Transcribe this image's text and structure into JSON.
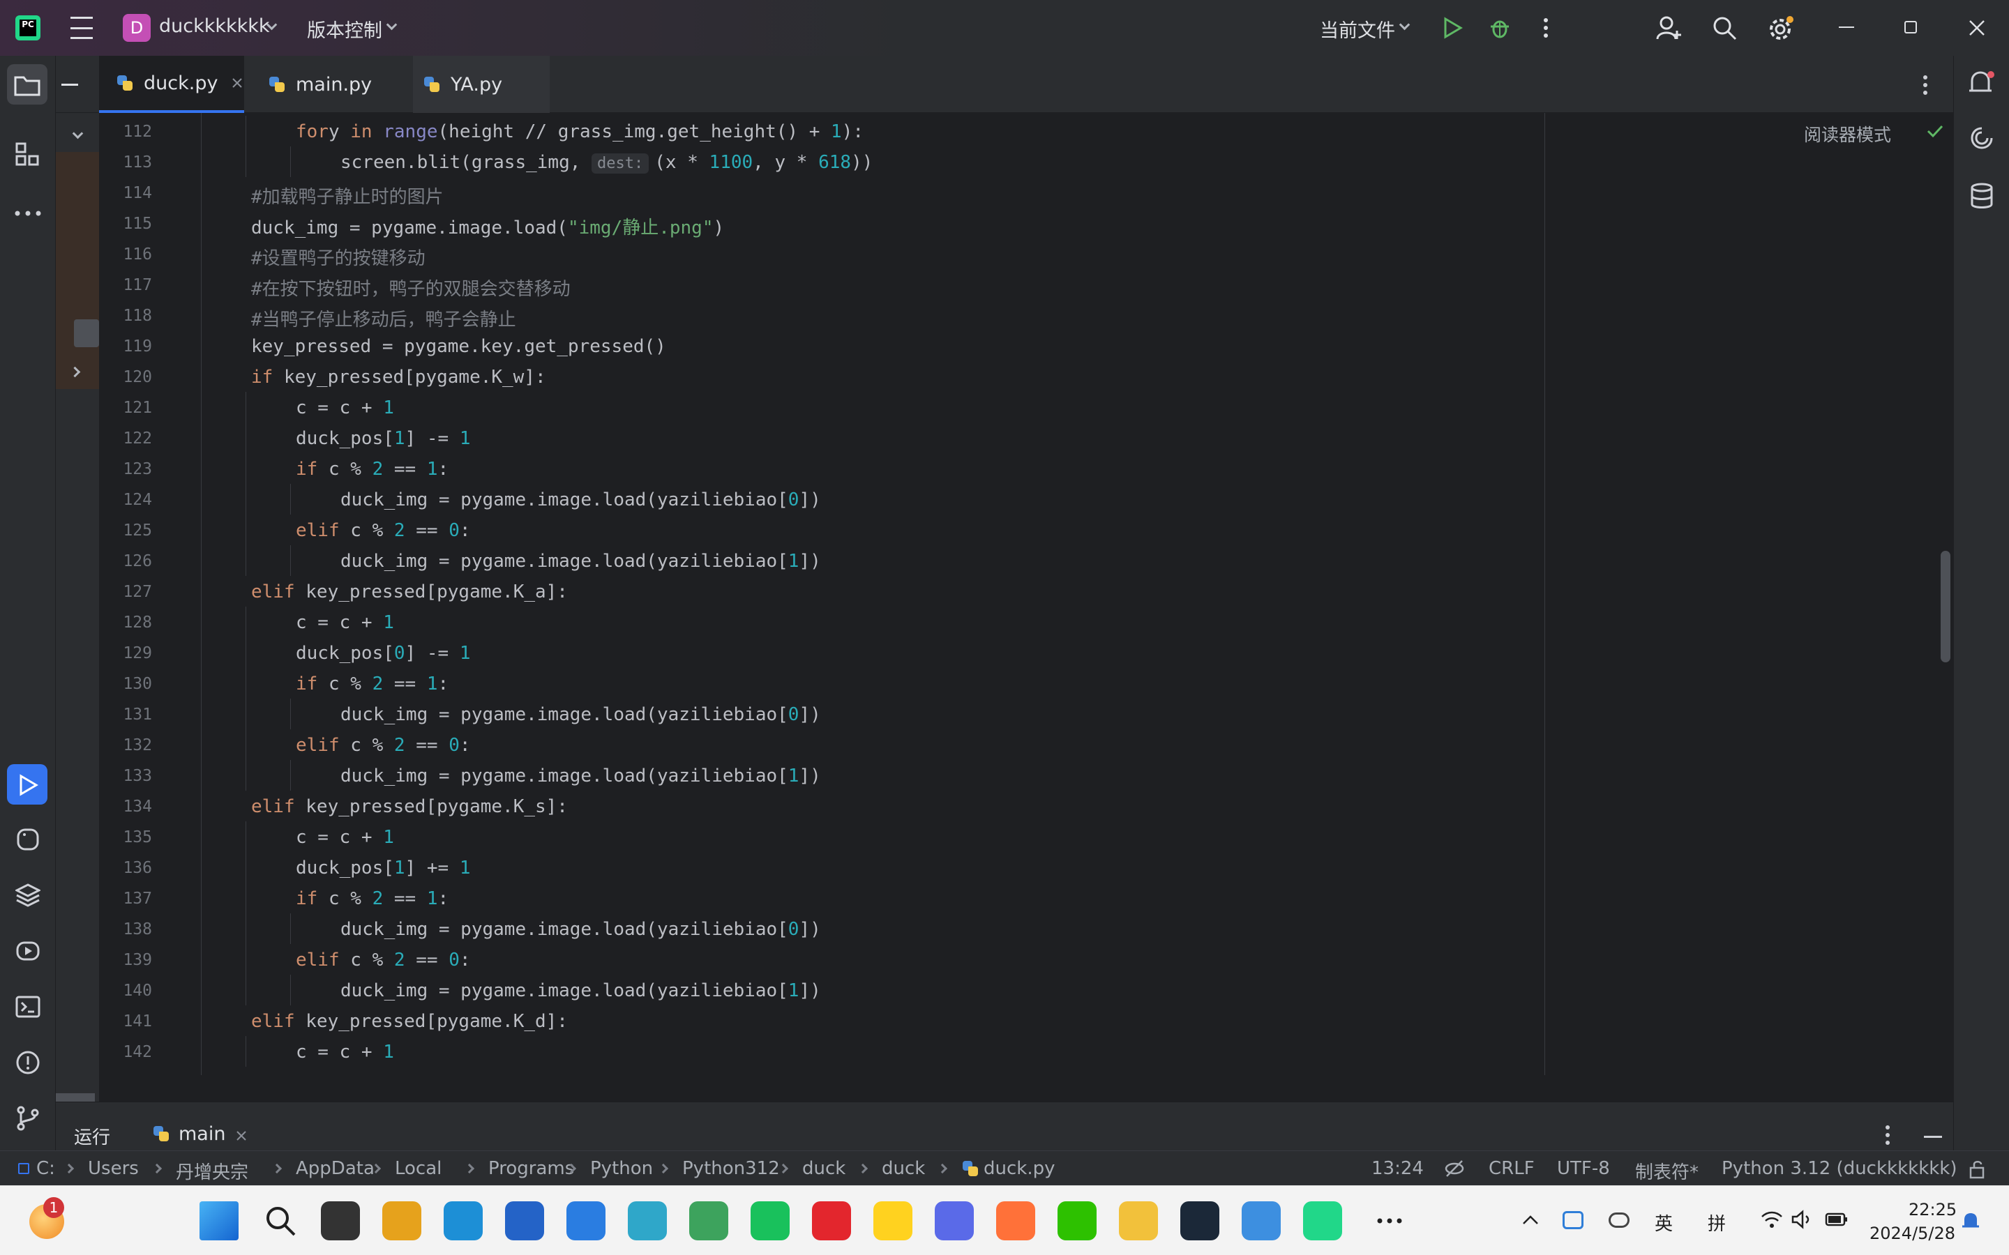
{
  "titlebar": {
    "project_initial": "D",
    "project_name": "duckkkkkkk",
    "vcs": "版本控制",
    "run_config": "当前文件"
  },
  "tabs": [
    {
      "label": "duck.py",
      "active": true
    },
    {
      "label": "main.py",
      "active": false
    },
    {
      "label": "YA.py",
      "active": false
    }
  ],
  "reader_mode": "阅读器模式",
  "inlay_hint": "dest:",
  "code_lines": [
    {
      "n": "112",
      "indent": 2,
      "tokens": [
        [
          "kw",
          "for"
        ],
        [
          "",
          "y "
        ],
        [
          "kw",
          "in"
        ],
        [
          "bi",
          " range"
        ],
        [
          "",
          "(height // grass_img.get_height() + "
        ],
        [
          "num",
          "1"
        ],
        [
          "",
          "):"
        ]
      ]
    },
    {
      "n": "113",
      "indent": 3,
      "tokens": [
        [
          "",
          "screen.blit(grass_img, "
        ],
        [
          "hint",
          ""
        ],
        [
          "",
          "(x * "
        ],
        [
          "num",
          "1100"
        ],
        [
          "",
          ", y * "
        ],
        [
          "num",
          "618"
        ],
        [
          "",
          "))"
        ]
      ]
    },
    {
      "n": "114",
      "indent": 1,
      "tokens": [
        [
          "cm",
          "#加载鸭子静止时的图片"
        ]
      ]
    },
    {
      "n": "115",
      "indent": 1,
      "tokens": [
        [
          "",
          "duck_img = pygame.image.load("
        ],
        [
          "str",
          "\"img/静止.png\""
        ],
        [
          "",
          ")"
        ]
      ]
    },
    {
      "n": "116",
      "indent": 1,
      "tokens": [
        [
          "cm",
          "#设置鸭子的按键移动"
        ]
      ]
    },
    {
      "n": "117",
      "indent": 1,
      "tokens": [
        [
          "cm",
          "#在按下按钮时，鸭子的双腿会交替移动"
        ]
      ]
    },
    {
      "n": "118",
      "indent": 1,
      "tokens": [
        [
          "cm",
          "#当鸭子停止移动后，鸭子会静止"
        ]
      ]
    },
    {
      "n": "119",
      "indent": 1,
      "tokens": [
        [
          "",
          "key_pressed = pygame.key.get_pressed()"
        ]
      ]
    },
    {
      "n": "120",
      "indent": 1,
      "tokens": [
        [
          "kw",
          "if"
        ],
        [
          "",
          " key_pressed[pygame.K_w]:"
        ]
      ]
    },
    {
      "n": "121",
      "indent": 2,
      "tokens": [
        [
          "",
          "c = c + "
        ],
        [
          "num",
          "1"
        ]
      ]
    },
    {
      "n": "122",
      "indent": 2,
      "tokens": [
        [
          "",
          "duck_pos["
        ],
        [
          "num",
          "1"
        ],
        [
          "",
          "] -= "
        ],
        [
          "num",
          "1"
        ]
      ]
    },
    {
      "n": "123",
      "indent": 2,
      "tokens": [
        [
          "kw",
          "if"
        ],
        [
          "",
          " c % "
        ],
        [
          "num",
          "2"
        ],
        [
          "",
          " == "
        ],
        [
          "num",
          "1"
        ],
        [
          "",
          ":"
        ]
      ]
    },
    {
      "n": "124",
      "indent": 3,
      "tokens": [
        [
          "",
          "duck_img = pygame.image.load(yaziliebiao["
        ],
        [
          "num",
          "0"
        ],
        [
          "",
          "])"
        ]
      ]
    },
    {
      "n": "125",
      "indent": 2,
      "tokens": [
        [
          "kw",
          "elif"
        ],
        [
          "",
          " c % "
        ],
        [
          "num",
          "2"
        ],
        [
          "",
          " == "
        ],
        [
          "num",
          "0"
        ],
        [
          "",
          ":"
        ]
      ]
    },
    {
      "n": "126",
      "indent": 3,
      "tokens": [
        [
          "",
          "duck_img = pygame.image.load(yaziliebiao["
        ],
        [
          "num",
          "1"
        ],
        [
          "",
          "])"
        ]
      ]
    },
    {
      "n": "127",
      "indent": 1,
      "tokens": [
        [
          "kw",
          "elif"
        ],
        [
          "",
          " key_pressed[pygame.K_a]:"
        ]
      ]
    },
    {
      "n": "128",
      "indent": 2,
      "tokens": [
        [
          "",
          "c = c + "
        ],
        [
          "num",
          "1"
        ]
      ]
    },
    {
      "n": "129",
      "indent": 2,
      "tokens": [
        [
          "",
          "duck_pos["
        ],
        [
          "num",
          "0"
        ],
        [
          "",
          "] -= "
        ],
        [
          "num",
          "1"
        ]
      ]
    },
    {
      "n": "130",
      "indent": 2,
      "tokens": [
        [
          "kw",
          "if"
        ],
        [
          "",
          " c % "
        ],
        [
          "num",
          "2"
        ],
        [
          "",
          " == "
        ],
        [
          "num",
          "1"
        ],
        [
          "",
          ":"
        ]
      ]
    },
    {
      "n": "131",
      "indent": 3,
      "tokens": [
        [
          "",
          "duck_img = pygame.image.load(yaziliebiao["
        ],
        [
          "num",
          "0"
        ],
        [
          "",
          "])"
        ]
      ]
    },
    {
      "n": "132",
      "indent": 2,
      "tokens": [
        [
          "kw",
          "elif"
        ],
        [
          "",
          " c % "
        ],
        [
          "num",
          "2"
        ],
        [
          "",
          " == "
        ],
        [
          "num",
          "0"
        ],
        [
          "",
          ":"
        ]
      ]
    },
    {
      "n": "133",
      "indent": 3,
      "tokens": [
        [
          "",
          "duck_img = pygame.image.load(yaziliebiao["
        ],
        [
          "num",
          "1"
        ],
        [
          "",
          "])"
        ]
      ]
    },
    {
      "n": "134",
      "indent": 1,
      "tokens": [
        [
          "kw",
          "elif"
        ],
        [
          "",
          " key_pressed[pygame.K_s]:"
        ]
      ]
    },
    {
      "n": "135",
      "indent": 2,
      "tokens": [
        [
          "",
          "c = c + "
        ],
        [
          "num",
          "1"
        ]
      ]
    },
    {
      "n": "136",
      "indent": 2,
      "tokens": [
        [
          "",
          "duck_pos["
        ],
        [
          "num",
          "1"
        ],
        [
          "",
          "] += "
        ],
        [
          "num",
          "1"
        ]
      ]
    },
    {
      "n": "137",
      "indent": 2,
      "tokens": [
        [
          "kw",
          "if"
        ],
        [
          "",
          " c % "
        ],
        [
          "num",
          "2"
        ],
        [
          "",
          " == "
        ],
        [
          "num",
          "1"
        ],
        [
          "",
          ":"
        ]
      ]
    },
    {
      "n": "138",
      "indent": 3,
      "tokens": [
        [
          "",
          "duck_img = pygame.image.load(yaziliebiao["
        ],
        [
          "num",
          "0"
        ],
        [
          "",
          "])"
        ]
      ]
    },
    {
      "n": "139",
      "indent": 2,
      "tokens": [
        [
          "kw",
          "elif"
        ],
        [
          "",
          " c % "
        ],
        [
          "num",
          "2"
        ],
        [
          "",
          " == "
        ],
        [
          "num",
          "0"
        ],
        [
          "",
          ":"
        ]
      ]
    },
    {
      "n": "140",
      "indent": 3,
      "tokens": [
        [
          "",
          "duck_img = pygame.image.load(yaziliebiao["
        ],
        [
          "num",
          "1"
        ],
        [
          "",
          "])"
        ]
      ]
    },
    {
      "n": "141",
      "indent": 1,
      "tokens": [
        [
          "kw",
          "elif"
        ],
        [
          "",
          " key_pressed[pygame.K_d]:"
        ]
      ]
    },
    {
      "n": "142",
      "indent": 2,
      "tokens": [
        [
          "",
          "c = c + "
        ],
        [
          "num",
          "1"
        ]
      ]
    }
  ],
  "bottom_tool": {
    "run_label": "运行",
    "run_tab": "main"
  },
  "breadcrumb": [
    "C:",
    "Users",
    "丹增央宗",
    "AppData",
    "Local",
    "Programs",
    "Python",
    "Python312",
    "duck",
    "duck",
    "duck.py"
  ],
  "status": {
    "position": "13:24",
    "line_sep": "CRLF",
    "encoding": "UTF-8",
    "indent": "制表符*",
    "interpreter": "Python 3.12 (duckkkkkkk)"
  },
  "taskbar": {
    "badge": "1",
    "ime_lang": "英",
    "ime_mode": "拼",
    "time": "22:25",
    "date": "2024/5/28"
  },
  "colors": {
    "accent": "#3574f0",
    "bg": "#1e1f22",
    "panel": "#2b2d30",
    "keyword": "#cf8e6d",
    "number": "#2aacb8",
    "string": "#6aab73",
    "comment": "#7a7e85"
  }
}
